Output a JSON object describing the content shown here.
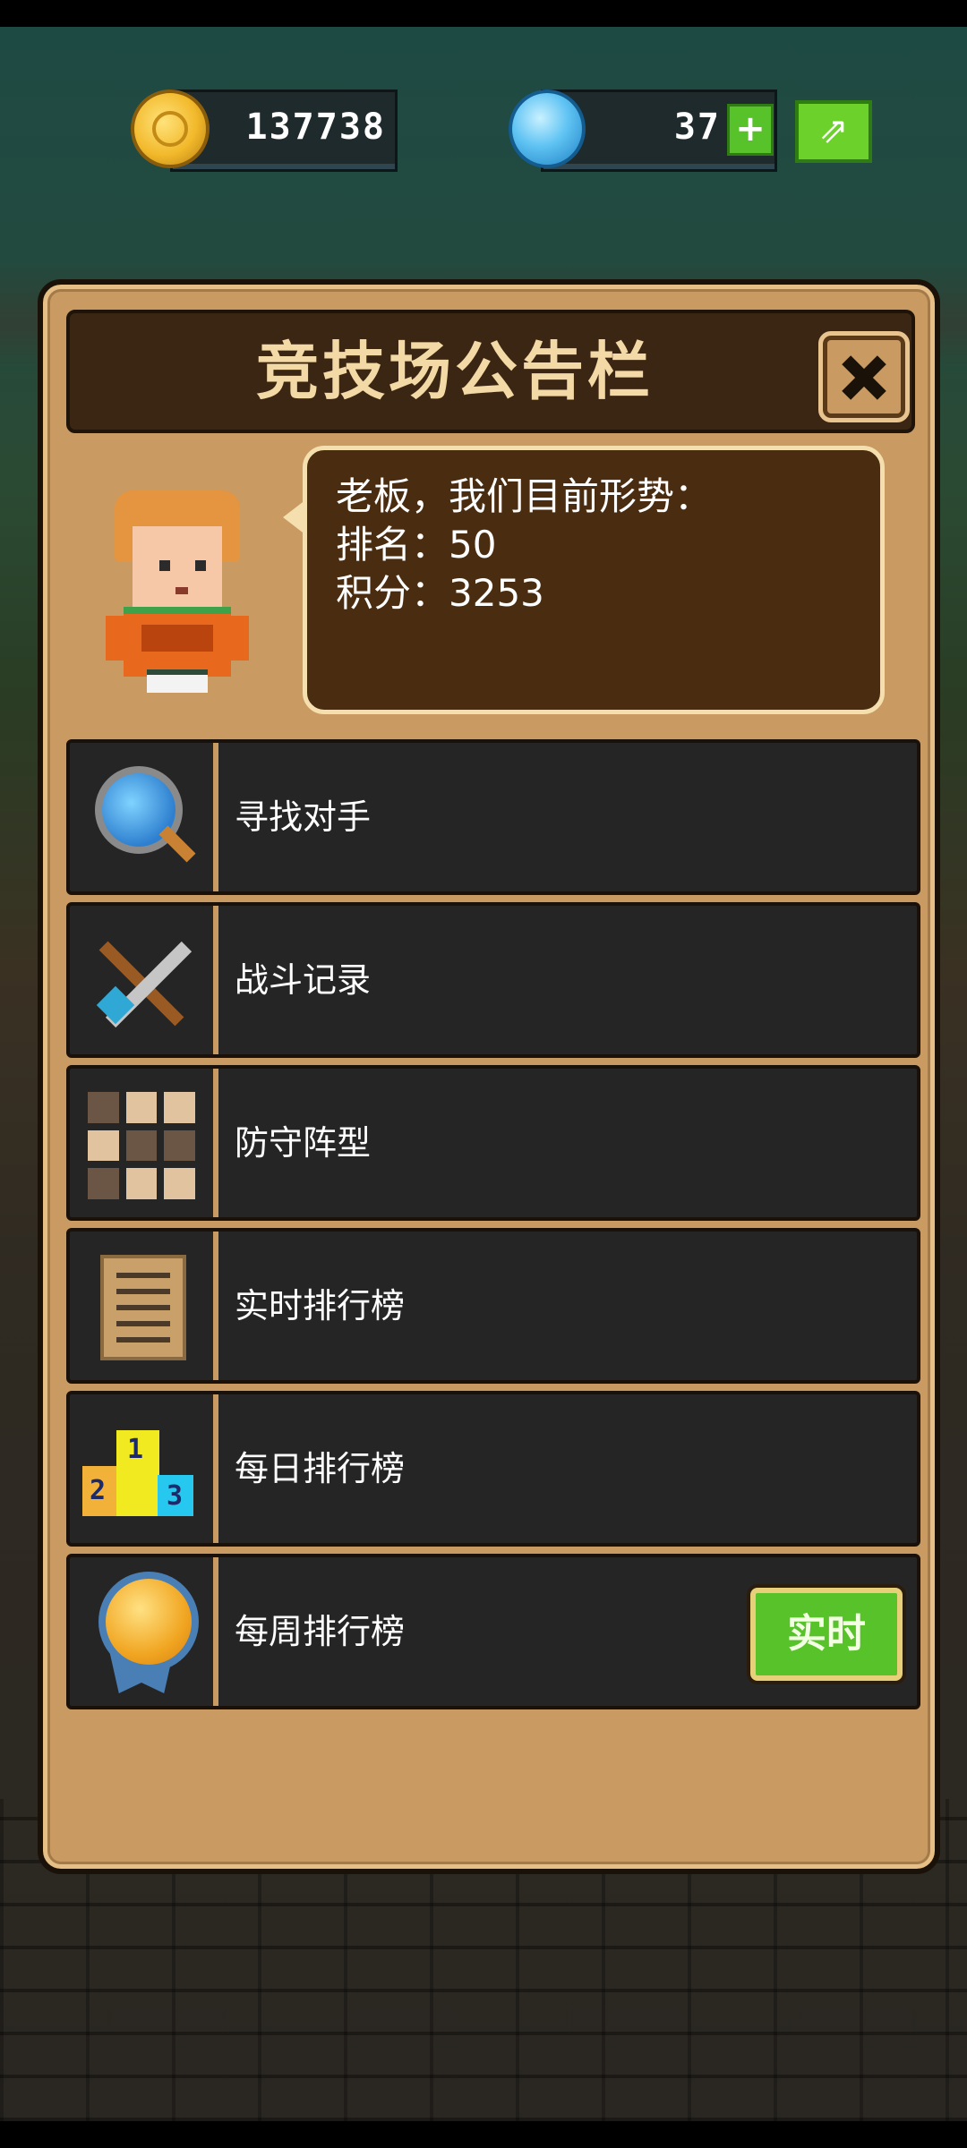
{
  "currency": {
    "coins": "137738",
    "gems": "37"
  },
  "panel": {
    "title": "竞技场公告栏",
    "bubble": {
      "line1": "老板，我们目前形势：",
      "line2": "排名：50",
      "line3": "积分：3253"
    }
  },
  "menu": {
    "items": [
      {
        "label": "寻找对手",
        "icon": "magnifier-icon"
      },
      {
        "label": "战斗记录",
        "icon": "crossed-swords-icon"
      },
      {
        "label": "防守阵型",
        "icon": "grid-formation-icon"
      },
      {
        "label": "实时排行榜",
        "icon": "scroll-list-icon"
      },
      {
        "label": "每日排行榜",
        "icon": "podium-icon"
      },
      {
        "label": "每周排行榜",
        "icon": "medal-icon"
      }
    ],
    "weekly_badge": "实时"
  },
  "podium_numbers": [
    "2",
    "1",
    "3"
  ],
  "colors": {
    "panel": "#c99b62",
    "row_bg": "#252525",
    "accent_green": "#58c22a"
  }
}
